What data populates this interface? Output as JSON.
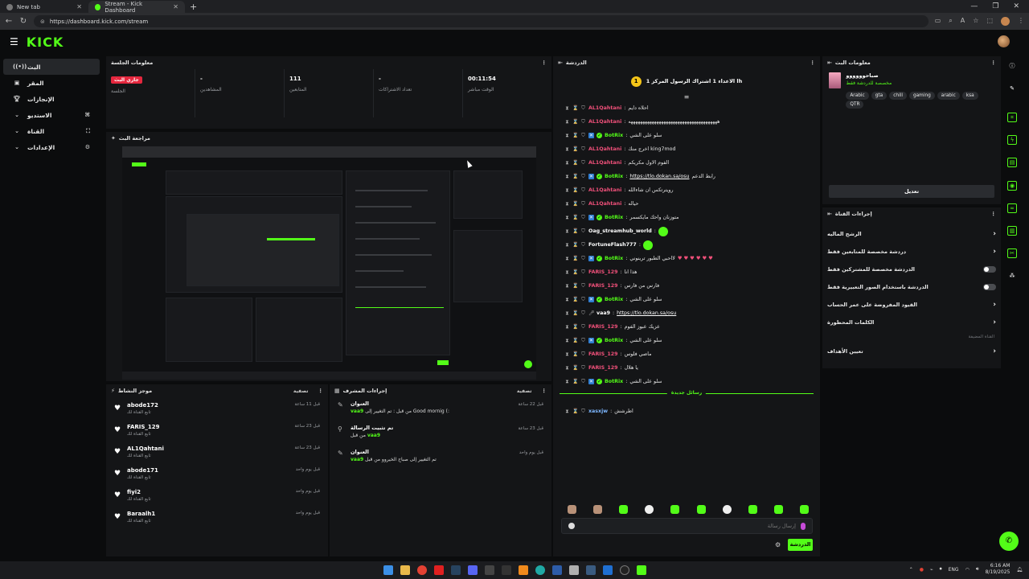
{
  "browser": {
    "tabs": [
      {
        "title": "New tab",
        "active": false
      },
      {
        "title": "Stream - Kick Dashboard",
        "active": true
      }
    ],
    "url": "https://dashboard.kick.com/stream"
  },
  "app": {
    "logo": "KICK"
  },
  "sidebar": {
    "items": [
      {
        "label": "البث",
        "icon": "broadcast-icon",
        "active": true
      },
      {
        "label": "المقر",
        "icon": "home-icon"
      },
      {
        "label": "الإنجازات",
        "icon": "trophy-icon"
      },
      {
        "label": "الاستديو",
        "icon": "studio-icon",
        "expandable": true
      },
      {
        "label": "القناة",
        "icon": "channel-icon",
        "expandable": true
      },
      {
        "label": "الإعدادات",
        "icon": "settings-icon",
        "expandable": true
      }
    ]
  },
  "session": {
    "title": "معلومات الجلسة",
    "live_badge": "جاري البث",
    "stats": [
      {
        "value": "",
        "label": "الجلسة"
      },
      {
        "value": "-",
        "label": "المشاهدين"
      },
      {
        "value": "111",
        "label": "المتابعين"
      },
      {
        "value": "-",
        "label": "تعداد الاشتراكات"
      },
      {
        "value": "00:11:54",
        "label": "الوقت مباشر"
      }
    ]
  },
  "preview": {
    "title": "مراجعة البث"
  },
  "activity": {
    "title": "موجز النشاط",
    "filter": "تصفية",
    "items": [
      {
        "name": "abode172",
        "sub": "تابع القناة لك",
        "time": "قبل 11 ساعة"
      },
      {
        "name": "FARIS_129",
        "sub": "تابع القناة لك",
        "time": "قبل 23 ساعة"
      },
      {
        "name": "AL1Qahtani",
        "sub": "تابع القناة لك",
        "time": "قبل 23 ساعة"
      },
      {
        "name": "abode171",
        "sub": "تابع القناة لك",
        "time": "قبل يوم واحد"
      },
      {
        "name": "fiyi2",
        "sub": "تابع القناة لك",
        "time": "قبل يوم واحد"
      },
      {
        "name": "Baraalh1",
        "sub": "تابع القناة لك",
        "time": "قبل يوم واحد"
      }
    ]
  },
  "moderation": {
    "title": "إجراءات المشرف",
    "filter": "تصفية",
    "items": [
      {
        "title": "العنوان",
        "user": "vaa9",
        "desc": "من قبل : تم التغيير إلى Good mornig (:",
        "time": "قبل 22 ساعة",
        "icon": "edit-icon"
      },
      {
        "title": "تم تثبيت الرسالة",
        "user": "vaa9",
        "desc": "من قبل",
        "time": "قبل 23 ساعة",
        "icon": "pin-icon"
      },
      {
        "title": "العنوان",
        "user": "vaa9",
        "desc": "تم التغيير إلى صباح الخيروو من قبل",
        "time": "قبل يوم واحد",
        "icon": "edit-icon"
      }
    ]
  },
  "chat": {
    "title": "الدردشة",
    "pinned_count": "1",
    "pinned_text": "الاعداء 1 اشتراك الرسول المركز 1 lh",
    "new_messages": "رسائل جديدة",
    "input_placeholder": "إرسال رسالة",
    "send_label": "الدردشة",
    "messages": [
      {
        "user": "AL1Qahtani",
        "color": "pink",
        "text": "احلاه دايم"
      },
      {
        "user": "AL1Qahtani",
        "color": "pink",
        "text": "ههههههههههههههههههههههههههههههههههههههه"
      },
      {
        "user": "BotRix",
        "color": "green",
        "badges": true,
        "text": "سلو على الشي"
      },
      {
        "user": "AL1Qahtani",
        "color": "pink",
        "text": "اخرج منك king7mod"
      },
      {
        "user": "AL1Qahtani",
        "color": "pink",
        "text": "الفوم الاول مكريكم"
      },
      {
        "user": "BotRix",
        "color": "green",
        "badges": true,
        "link": "https://tlo.dokan.sa/osu",
        "text": "رابط الدعم"
      },
      {
        "user": "AL1Qahtani",
        "color": "pink",
        "text": "رويترتكس ان شاءالله"
      },
      {
        "user": "AL1Qahtani",
        "color": "pink",
        "text": "حياله"
      },
      {
        "user": "BotRix",
        "color": "green",
        "badges": true,
        "text": "متوزنان واحك مايكسمر"
      },
      {
        "user": "Oag_streamhub_world",
        "color": "white",
        "text": "",
        "emote": true
      },
      {
        "user": "FortuneFlash777",
        "color": "white",
        "text": "",
        "emote": true
      },
      {
        "user": "BotRix",
        "color": "green",
        "badges": true,
        "text": "لااحبي الطبور ترينوني",
        "hearts": "♥ ♥ ♥ ♥ ♥ ♥"
      },
      {
        "user": "FARIS_129",
        "color": "pink",
        "text": "هذا انا"
      },
      {
        "user": "FARIS_129",
        "color": "pink",
        "text": "فارس من فارس"
      },
      {
        "user": "BotRix",
        "color": "green",
        "badges": true,
        "text": "سلو على الشي"
      },
      {
        "user": "vaa9",
        "color": "white",
        "mic": true,
        "link": "https://tlo.dokan.sa/osu",
        "text": ""
      },
      {
        "user": "FARIS_129",
        "color": "pink",
        "text": "عزيك عبوز الفوم"
      },
      {
        "user": "BotRix",
        "color": "green",
        "badges": true,
        "text": "سلو على الشي"
      },
      {
        "user": "FARIS_129",
        "color": "pink",
        "text": "ماصي فلوس"
      },
      {
        "user": "FARIS_129",
        "color": "pink",
        "text": "يا هلال"
      },
      {
        "user": "BotRix",
        "color": "green",
        "badges": true,
        "text": "سلو على الشي"
      }
    ],
    "after_new": [
      {
        "user": "xasxjw",
        "color": "blue",
        "text": "اطرشش"
      }
    ]
  },
  "stream_info": {
    "title": "معلومات البث",
    "stream_title": "صباحوووووو",
    "category": "مخصصة للدردشة فقط",
    "tags": [
      "Arabic",
      "gta",
      "chill",
      "gaming",
      "arabic",
      "ksa",
      "QTR"
    ],
    "edit_label": "تعديل"
  },
  "channel_actions": {
    "title": "إجراءات القناة",
    "rows": [
      {
        "label": "الرشح الماليه",
        "control": "chevron"
      },
      {
        "label": "دردشة مخصصة للمتابعين فقط",
        "control": "chevron"
      },
      {
        "label": "الدردشة مخصصة للمشتركين فقط",
        "control": "toggle"
      },
      {
        "label": "الدردشة باستخدام الصور التعبيرية فقط",
        "control": "toggle"
      },
      {
        "label": "القيود المفروضة على عمر الحساب",
        "control": "chevron"
      },
      {
        "label": "الكلمات المحظورة",
        "control": "chevron"
      }
    ],
    "section_note": "القناة المضيفة",
    "extra_row": "تعيين الأهداف"
  },
  "taskbar": {
    "lang": "ENG",
    "time": "6:16 AM",
    "date": "8/19/2025"
  }
}
